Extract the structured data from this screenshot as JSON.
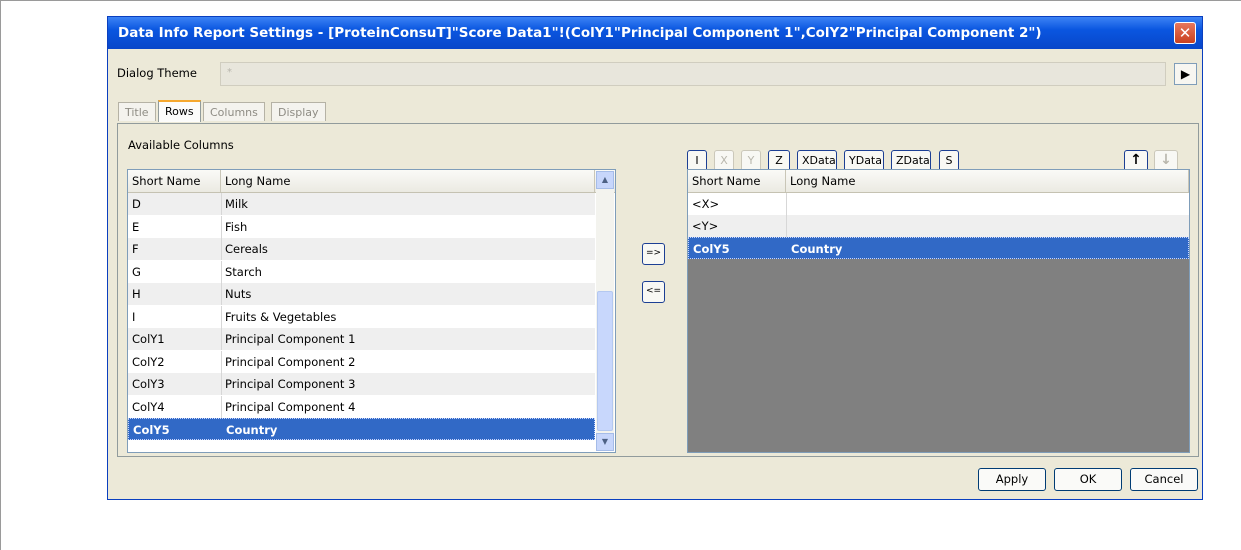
{
  "dialog": {
    "title": "Data Info Report Settings - [ProteinConsuT]\"Score Data1\"!(ColY1\"Principal Component 1\",ColY2\"Principal Component 2\")",
    "close_glyph": "✕"
  },
  "theme": {
    "label": "Dialog Theme",
    "value": "*",
    "arrow_glyph": "▶"
  },
  "tabs": [
    {
      "label": "Title",
      "active": false
    },
    {
      "label": "Rows",
      "active": true
    },
    {
      "label": "Columns",
      "active": false
    },
    {
      "label": "Display",
      "active": false
    }
  ],
  "available": {
    "label": "Available Columns",
    "headers": [
      "Short Name",
      "Long Name"
    ],
    "rows": [
      {
        "short": "D",
        "long": "Milk"
      },
      {
        "short": "E",
        "long": "Fish"
      },
      {
        "short": "F",
        "long": "Cereals"
      },
      {
        "short": "G",
        "long": "Starch"
      },
      {
        "short": "H",
        "long": "Nuts"
      },
      {
        "short": "I",
        "long": "Fruits & Vegetables"
      },
      {
        "short": "ColY1",
        "long": "Principal Component 1"
      },
      {
        "short": "ColY2",
        "long": "Principal Component 2"
      },
      {
        "short": "ColY3",
        "long": "Principal Component 3"
      },
      {
        "short": "ColY4",
        "long": "Principal Component 4"
      },
      {
        "short": "ColY5",
        "long": "Country"
      }
    ],
    "selected_index": 10
  },
  "move": {
    "add_label": "=>",
    "remove_label": "<="
  },
  "toolbar": {
    "buttons": [
      {
        "label": "I",
        "disabled": false
      },
      {
        "label": "X",
        "disabled": true
      },
      {
        "label": "Y",
        "disabled": true
      },
      {
        "label": "Z",
        "disabled": false
      },
      {
        "label": "XData",
        "disabled": false
      },
      {
        "label": "YData",
        "disabled": false
      },
      {
        "label": "ZData",
        "disabled": false
      },
      {
        "label": "S",
        "disabled": false
      }
    ],
    "up_glyph": "🡑",
    "down_glyph": "🡓"
  },
  "selected": {
    "headers": [
      "Short Name",
      "Long Name"
    ],
    "rows": [
      {
        "short": "<X>",
        "long": ""
      },
      {
        "short": "<Y>",
        "long": ""
      },
      {
        "short": "ColY5",
        "long": "Country"
      }
    ],
    "selected_index": 2
  },
  "footer": {
    "apply": "Apply",
    "ok": "OK",
    "cancel": "Cancel"
  },
  "colors": {
    "title_bar": "#0a56e0",
    "selection": "#3169c6",
    "dialog_bg": "#ece9d8",
    "empty_grid": "#808080"
  }
}
